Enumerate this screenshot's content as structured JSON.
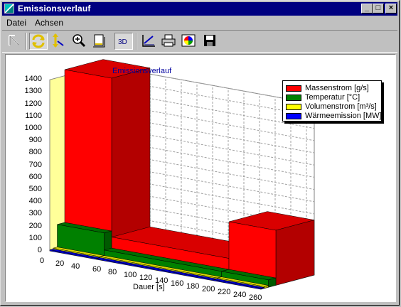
{
  "window": {
    "title": "Emissionsverlauf",
    "minimize": "_",
    "maximize": "□",
    "close": "×"
  },
  "menu": [
    {
      "label": "Datei"
    },
    {
      "label": "Achsen"
    }
  ],
  "toolbar": {
    "tools": [
      {
        "icon": "pointer-icon"
      },
      {
        "icon": "rotate-icon",
        "pressed": true
      },
      {
        "icon": "scale-axis-icon"
      },
      {
        "icon": "zoom-icon"
      },
      {
        "icon": "page-icon"
      },
      {
        "icon": "3d-toggle-icon",
        "label": "3D",
        "pressed": true
      },
      {
        "icon": "chart-edit-icon"
      },
      {
        "icon": "print-icon"
      },
      {
        "icon": "color-palette-icon"
      },
      {
        "icon": "save-icon"
      }
    ]
  },
  "chart_data": {
    "type": "bar",
    "title": "Emissionsverlauf",
    "xlabel": "Dauer [s]",
    "ylabel": "",
    "ylim": [
      0,
      1400
    ],
    "yticks": [
      "0",
      "100",
      "200",
      "300",
      "400",
      "500",
      "600",
      "700",
      "800",
      "900",
      "1000",
      "1100",
      "1200",
      "1300",
      "1400"
    ],
    "xticks": [
      "0",
      "20",
      "40",
      "60",
      "80",
      "100",
      "120",
      "140",
      "160",
      "180",
      "200",
      "220",
      "240",
      "260"
    ],
    "stacked_3d": true,
    "grid": true,
    "legend_position": "top-right",
    "x_segments": [
      {
        "from": 0,
        "to": 60
      },
      {
        "from": 60,
        "to": 210
      },
      {
        "from": 210,
        "to": 270
      }
    ],
    "series": [
      {
        "name": "Massenstrom [g/s]",
        "color": "#ff0000",
        "values": [
          1450,
          150,
          450
        ]
      },
      {
        "name": "Temperatur [°C]",
        "color": "#008000",
        "values": [
          200,
          60,
          60
        ]
      },
      {
        "name": "Volumenstrom [m³/s]",
        "color": "#ffff00",
        "values": [
          15,
          15,
          15
        ]
      },
      {
        "name": "Wärmeemission [MW]",
        "color": "#0000ff",
        "values": [
          8,
          8,
          8
        ]
      }
    ]
  }
}
